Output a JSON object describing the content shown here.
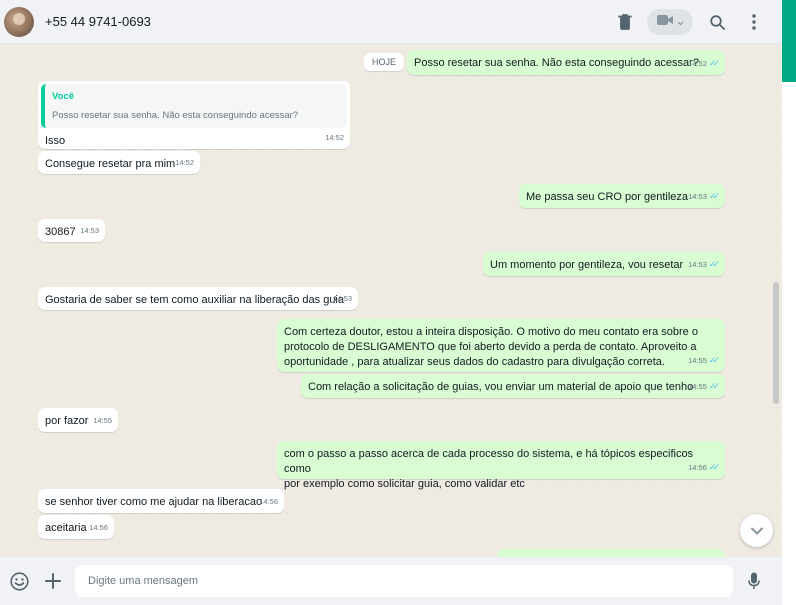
{
  "header": {
    "contact_name": "+55 44 9741-0693",
    "icons": [
      "trash-icon",
      "video-icon",
      "search-icon",
      "menu-icon"
    ]
  },
  "chat": {
    "day_separator": "HOJE",
    "messages": [
      {
        "dir": "out",
        "text": "Posso resetar sua senha. Não esta conseguindo acessar?",
        "time": "14:52",
        "read": true
      },
      {
        "dir": "in",
        "quote_author": "Você",
        "quote_text": "Posso resetar sua senha. Não esta conseguindo acessar?",
        "text": "Isso",
        "time": "14:52"
      },
      {
        "dir": "in",
        "text": "Consegue resetar pra mim",
        "time": "14:52"
      },
      {
        "dir": "out",
        "text": "Me passa seu CRO por gentileza",
        "time": "14:53",
        "read": true
      },
      {
        "dir": "in",
        "text": "30867",
        "time": "14:53"
      },
      {
        "dir": "out",
        "text": "Um momento por gentileza, vou resetar",
        "time": "14:53",
        "read": true
      },
      {
        "dir": "in",
        "text": "Gostaria de saber se tem como auxiliar na liberação das guia",
        "time": "14:53"
      },
      {
        "dir": "out",
        "lines": [
          "Com certeza doutor, estou a inteira disposição. O motivo do meu contato era sobre o",
          "protocolo de DESLIGAMENTO que foi aberto devido a perda de contato. Aproveito a",
          "oportunidade , para atualizar seus dados do cadastro para divulgação correta."
        ],
        "time": "14:55",
        "read": true
      },
      {
        "dir": "out",
        "text": "Com relação a solicitação de guias, vou enviar um material de apoio que tenho",
        "time": "14:55",
        "read": true
      },
      {
        "dir": "in",
        "text": "por fazor",
        "time": "14:55"
      },
      {
        "dir": "out",
        "lines": [
          "com o passo a passo acerca de cada processo do sistema, e há tópicos especificos como",
          "por exemplo como solicitar guia, como validar etc"
        ],
        "time": "14:56",
        "read": true
      },
      {
        "dir": "in",
        "text": "se senhor tiver como me ajudar na liberacao",
        "time": "14:56"
      },
      {
        "dir": "in",
        "text": "aceitaria",
        "time": "14:56"
      }
    ]
  },
  "footer": {
    "input_placeholder": "Digite uma mensagem",
    "icons": [
      "emoji-icon",
      "attach-plus-icon",
      "microphone-icon"
    ]
  },
  "colors": {
    "accent": "#00a884",
    "outgoing_bubble": "#d9fdd3",
    "incoming_bubble": "#ffffff",
    "read_ticks": "#53bdeb",
    "chat_background": "#efeae2"
  }
}
